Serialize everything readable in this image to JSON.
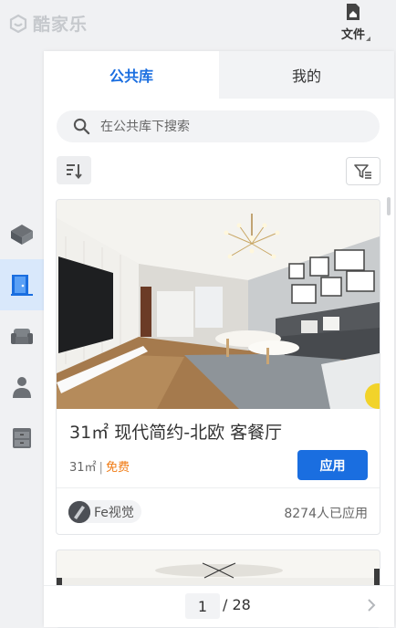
{
  "brand": {
    "name": "酷家乐"
  },
  "toolbar": {
    "file_label": "文件"
  },
  "left_toolbar": {
    "items": [
      {
        "icon": "cube-icon"
      },
      {
        "icon": "door-icon",
        "active": true
      },
      {
        "icon": "sofa-icon"
      },
      {
        "icon": "person-icon"
      },
      {
        "icon": "cabinet-icon"
      }
    ]
  },
  "tabs": [
    {
      "label": "公共库",
      "active": true
    },
    {
      "label": "我的",
      "active": false
    }
  ],
  "search": {
    "placeholder": "在公共库下搜索",
    "value": ""
  },
  "card": {
    "title": "31㎡ 现代简约-北欧 客餐厅",
    "area": "31㎡",
    "separator": "|",
    "price": "免费",
    "apply_label": "应用",
    "author": "Fe视觉",
    "usage": "8274人已应用"
  },
  "pagination": {
    "current": "1",
    "total_text": "/ 28"
  },
  "colors": {
    "accent": "#1a6ee0",
    "free": "#f07a12",
    "active_left": "#d9e8fb"
  }
}
